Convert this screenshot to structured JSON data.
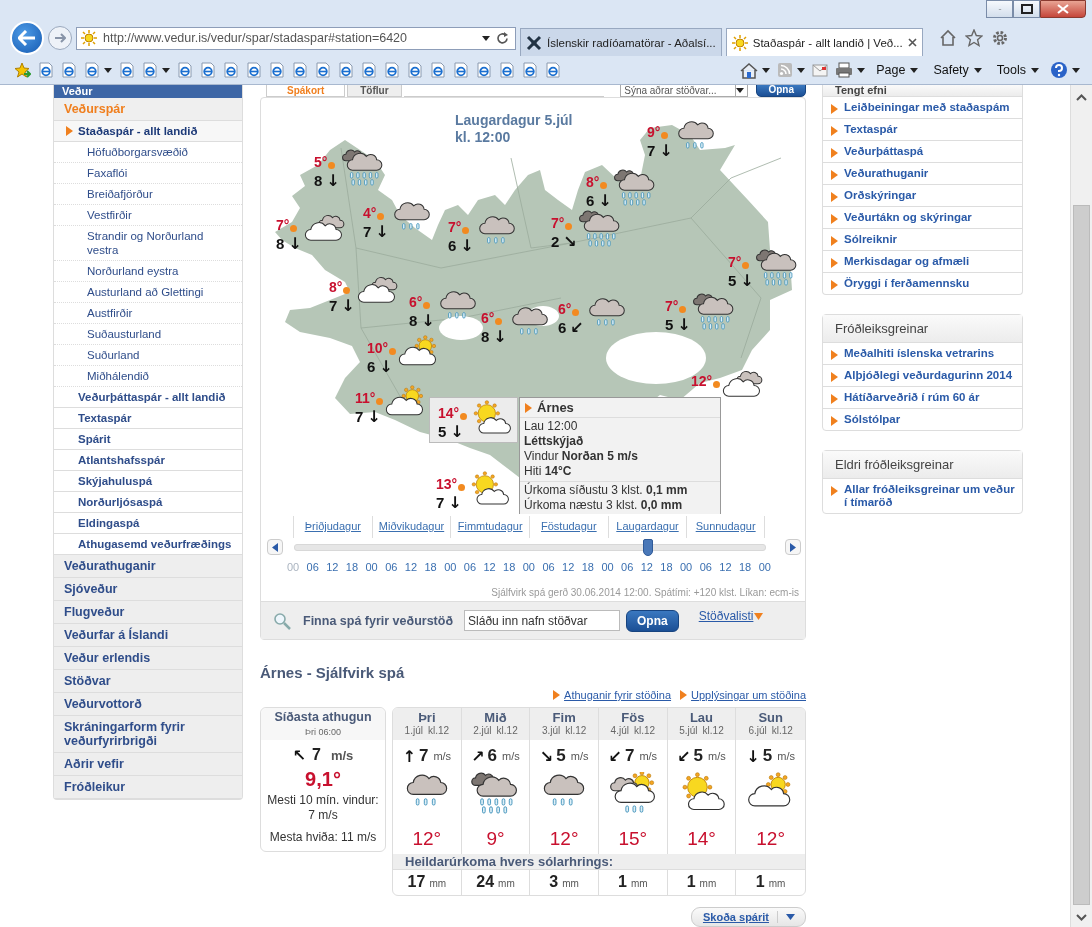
{
  "browser": {
    "address": "http://www.vedur.is/vedur/spar/stadaspar#station=6420",
    "tabs": [
      {
        "title": "Íslenskir radíóamatörar - Aðalsí...",
        "selected": false
      },
      {
        "title": "Staðaspár - allt landið | Veð...",
        "selected": true
      }
    ],
    "menus": [
      "Page",
      "Safety",
      "Tools"
    ]
  },
  "sidebar": {
    "header": "Veður",
    "items": [
      {
        "label": "Veðurspár",
        "selected": true,
        "children": [
          {
            "label": "Staðaspár - allt landið",
            "selected": true,
            "children": [
              {
                "label": "Höfuðborgarsvæðið",
                "selected": false
              },
              {
                "label": "Faxaflói",
                "selected": false
              },
              {
                "label": "Breiðafjörður",
                "selected": false
              },
              {
                "label": "Vestfirðir",
                "selected": false
              },
              {
                "label": "Strandir og Norðurland vestra",
                "selected": false
              },
              {
                "label": "Norðurland eystra",
                "selected": false
              },
              {
                "label": "Austurland að Glettingi",
                "selected": false
              },
              {
                "label": "Austfirðir",
                "selected": false
              },
              {
                "label": "Suðausturland",
                "selected": false
              },
              {
                "label": "Suðurland",
                "selected": false
              },
              {
                "label": "Miðhálendið",
                "selected": false
              }
            ]
          },
          {
            "label": "Veðurþáttaspár - allt landið",
            "selected": false
          },
          {
            "label": "Textaspár",
            "selected": false
          },
          {
            "label": "Spárit",
            "selected": false
          },
          {
            "label": "Atlantshafsspár",
            "selected": false
          },
          {
            "label": "Skýjahuluspá",
            "selected": false
          },
          {
            "label": "Norðurljósaspá",
            "selected": false
          },
          {
            "label": "Eldingaspá",
            "selected": false
          },
          {
            "label": "Athugasemd veðurfræðings",
            "selected": false
          }
        ]
      },
      {
        "label": "Veðurathuganir",
        "selected": false
      },
      {
        "label": "Sjóveður",
        "selected": false
      },
      {
        "label": "Flugveður",
        "selected": false
      },
      {
        "label": "Veðurfar á Íslandi",
        "selected": false
      },
      {
        "label": "Veður erlendis",
        "selected": false
      },
      {
        "label": "Stöðvar",
        "selected": false
      },
      {
        "label": "Veðurvottorð",
        "selected": false
      },
      {
        "label": "Skráningarform fyrir veðurfyrirbrigði",
        "selected": false
      },
      {
        "label": "Aðrir vefir",
        "selected": false
      },
      {
        "label": "Fróðleikur",
        "selected": false
      }
    ]
  },
  "map_panel": {
    "tabs": [
      {
        "label": "Spákort",
        "selected": true
      },
      {
        "label": "Töflur",
        "selected": false
      }
    ],
    "station_select": {
      "value": "Sýna aðrar stöðvar..."
    },
    "open_button": "Opna",
    "title": "Laugardagur 5.júl",
    "time": "kl. 12:00",
    "stations": [
      {
        "temp": "5°",
        "wind": "8",
        "arrow": "↓",
        "kind": "heavy-rain",
        "selected": false
      },
      {
        "temp": "7°",
        "wind": "8",
        "arrow": "↓",
        "kind": "cloudy",
        "selected": false
      },
      {
        "temp": "4°",
        "wind": "7",
        "arrow": "↓",
        "kind": "rain",
        "selected": false
      },
      {
        "temp": "7°",
        "wind": "6",
        "arrow": "↓",
        "kind": "rain",
        "selected": false
      },
      {
        "temp": "9°",
        "wind": "7",
        "arrow": "↓",
        "kind": "rain",
        "selected": false
      },
      {
        "temp": "8°",
        "wind": "6",
        "arrow": "↓",
        "kind": "heavy-rain",
        "selected": false
      },
      {
        "temp": "7°",
        "wind": "2",
        "arrow": "↘",
        "kind": "heavy-rain",
        "selected": false
      },
      {
        "temp": "7°",
        "wind": "5",
        "arrow": "↓",
        "kind": "heavy-rain",
        "selected": false
      },
      {
        "temp": "8°",
        "wind": "7",
        "arrow": "↓",
        "kind": "cloudy",
        "selected": false
      },
      {
        "temp": "6°",
        "wind": "8",
        "arrow": "↓",
        "kind": "rain",
        "selected": false
      },
      {
        "temp": "6°",
        "wind": "8",
        "arrow": "↓",
        "kind": "rain",
        "selected": false
      },
      {
        "temp": "6°",
        "wind": "6",
        "arrow": "↙",
        "kind": "rain",
        "selected": false
      },
      {
        "temp": "7°",
        "wind": "5",
        "arrow": "↓",
        "kind": "heavy-rain",
        "selected": false
      },
      {
        "temp": "10°",
        "wind": "6",
        "arrow": "↓",
        "kind": "partly-sunny",
        "selected": false
      },
      {
        "temp": "11°",
        "wind": "7",
        "arrow": "↓",
        "kind": "partly-sunny",
        "selected": false
      },
      {
        "temp": "12°",
        "kind": "cloudy",
        "selected": false
      },
      {
        "temp": "14°",
        "wind": "5",
        "arrow": "↓",
        "kind": "mostly-sunny",
        "selected": true
      },
      {
        "temp": "13°",
        "wind": "7",
        "arrow": "↓",
        "kind": "mostly-sunny",
        "selected": false
      }
    ],
    "tooltip": {
      "title": "Árnes",
      "time": "Lau 12:00",
      "condition": "Léttskýjað",
      "wind": "Vindur  **Norðan 5 m/s**",
      "temperature": "Hiti  **14°C**",
      "precip": [
        "Úrkoma síðustu 3 klst. **0,1 mm**",
        "Úrkoma næstu 3 klst. **0,0 mm**"
      ]
    },
    "timeline": {
      "days": [
        "Þriðjudagur",
        "Miðvikudagur",
        "Fimmtudagur",
        "Föstudagur",
        "Laugardagur",
        "Sunnudagur"
      ],
      "hours": [
        {
          "label": "00",
          "past": true
        },
        {
          "label": "06",
          "past": false
        },
        {
          "label": "12",
          "past": false
        },
        {
          "label": "18",
          "past": false
        },
        {
          "label": "00",
          "past": false
        },
        {
          "label": "06",
          "past": false
        },
        {
          "label": "12",
          "past": false
        },
        {
          "label": "18",
          "past": false
        },
        {
          "label": "00",
          "past": false
        },
        {
          "label": "06",
          "past": false
        },
        {
          "label": "12",
          "past": false
        },
        {
          "label": "18",
          "past": false
        },
        {
          "label": "00",
          "past": false
        },
        {
          "label": "06",
          "past": false
        },
        {
          "label": "12",
          "past": false
        },
        {
          "label": "18",
          "past": false
        },
        {
          "label": "00",
          "past": false
        },
        {
          "label": "06",
          "past": false
        },
        {
          "label": "12",
          "past": false
        },
        {
          "label": "18",
          "past": false
        },
        {
          "label": "00",
          "past": false
        },
        {
          "label": "06",
          "past": false
        },
        {
          "label": "12",
          "past": false
        },
        {
          "label": "18",
          "past": false
        },
        {
          "label": "00",
          "past": false
        }
      ],
      "level": 0.75
    },
    "footnote": "Sjálfvirk spá gerð 30.06.2014 12:00. Spátími: +120 klst. Líkan: ecm-is",
    "search": {
      "label": "Finna spá fyrir veðurstöð",
      "placeholder": "Sláðu inn nafn stöðvar",
      "button": "Opna",
      "link": "Stöðvalisti"
    }
  },
  "station_forecast": {
    "title": "Árnes - Sjálfvirk spá",
    "links": [
      "Athuganir fyrir stöðina",
      "Upplýsingar um stöðina"
    ],
    "last_observation": {
      "title": "Síðasta athugun",
      "time": "Þri 06:00",
      "arrow": "↖",
      "wind": "7",
      "unit": "m/s",
      "temp": "9,1°",
      "max_wind": "Mesti 10 mín. vindur: 7 m/s",
      "max_gust": "Mesta hviða: 11 m/s"
    },
    "days": [
      {
        "day": "Þri",
        "date": "1.júl",
        "hour": "kl.12",
        "arrow": "↑",
        "wind": "7",
        "unit": "m/s",
        "kind": "rain",
        "temp": "12°",
        "precip": "17",
        "precip_unit": "mm"
      },
      {
        "day": "Mið",
        "date": "2.júl",
        "hour": "kl.12",
        "arrow": "↗",
        "wind": "6",
        "unit": "m/s",
        "kind": "heavy-rain",
        "temp": "9°",
        "precip": "24",
        "precip_unit": "mm"
      },
      {
        "day": "Fim",
        "date": "3.júl",
        "hour": "kl.12",
        "arrow": "↘",
        "wind": "5",
        "unit": "m/s",
        "kind": "rain",
        "temp": "12°",
        "precip": "3",
        "precip_unit": "mm"
      },
      {
        "day": "Fös",
        "date": "4.júl",
        "hour": "kl.12",
        "arrow": "↙",
        "wind": "7",
        "unit": "m/s",
        "kind": "showers",
        "temp": "15°",
        "precip": "1",
        "precip_unit": "mm"
      },
      {
        "day": "Lau",
        "date": "5.júl",
        "hour": "kl.12",
        "arrow": "↙",
        "wind": "5",
        "unit": "m/s",
        "kind": "mostly-sunny",
        "temp": "14°",
        "precip": "1",
        "precip_unit": "mm"
      },
      {
        "day": "Sun",
        "date": "6.júl",
        "hour": "kl.12",
        "arrow": "↓",
        "wind": "5",
        "unit": "m/s",
        "kind": "partly-sunny",
        "temp": "12°",
        "precip": "1",
        "precip_unit": "mm"
      }
    ],
    "precip_title": "Heildarúrkoma hvers sólarhrings:",
    "chart_button": "Skoða spárit"
  },
  "related": [
    {
      "title": "Tengt efni",
      "links": [
        "Leiðbeiningar með staðaspám",
        "Textaspár",
        "Veðurþáttaspá",
        "Veðurathuganir",
        "Orðskýringar",
        "Veðurtákn og skýringar",
        "Sólreiknir",
        "Merkisdagar og afmæli",
        "Öryggi í ferðamennsku"
      ]
    },
    {
      "title": "Fróðleiksgreinar",
      "links": [
        "Meðalhiti íslenska vetrarins",
        "Alþjóðlegi veðurdagurinn 2014",
        "Hátíðarveðrið í rúm 60 ár",
        "Sólstólpar"
      ]
    },
    {
      "title": "Eldri fróðleiksgreinar",
      "links": [
        "Allar fróðleiksgreinar um veður í tímaröð"
      ]
    }
  ]
}
